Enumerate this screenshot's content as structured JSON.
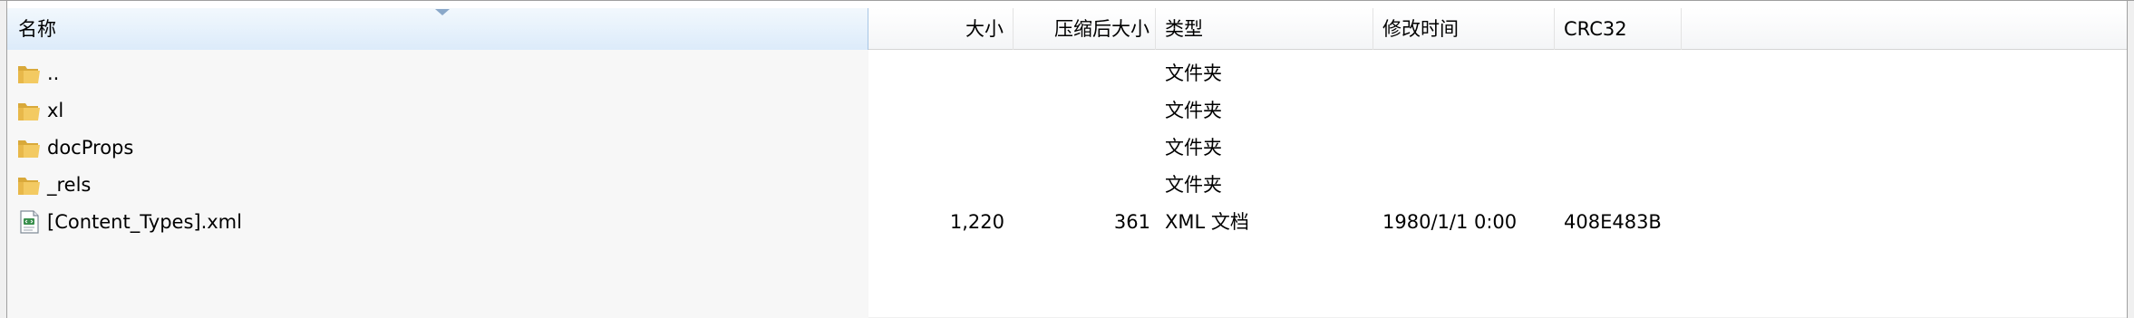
{
  "columns": {
    "name": "名称",
    "size": "大小",
    "packed_size": "压缩后大小",
    "type": "类型",
    "modified": "修改时间",
    "crc": "CRC32"
  },
  "rows": [
    {
      "icon": "folder-icon",
      "name": "..",
      "size": "",
      "packed_size": "",
      "type": "文件夹",
      "modified": "",
      "crc": ""
    },
    {
      "icon": "folder-icon",
      "name": "xl",
      "size": "",
      "packed_size": "",
      "type": "文件夹",
      "modified": "",
      "crc": ""
    },
    {
      "icon": "folder-icon",
      "name": "docProps",
      "size": "",
      "packed_size": "",
      "type": "文件夹",
      "modified": "",
      "crc": ""
    },
    {
      "icon": "folder-icon",
      "name": "_rels",
      "size": "",
      "packed_size": "",
      "type": "文件夹",
      "modified": "",
      "crc": ""
    },
    {
      "icon": "xml-file-icon",
      "name": "[Content_Types].xml",
      "size": "1,220",
      "packed_size": "361",
      "type": "XML 文档",
      "modified": "1980/1/1 0:00",
      "crc": "408E483B"
    }
  ],
  "colors": {
    "folder": "#e8b84a",
    "sorted_header": "#dcebfa",
    "sort_arrow": "#8aa8c9"
  }
}
